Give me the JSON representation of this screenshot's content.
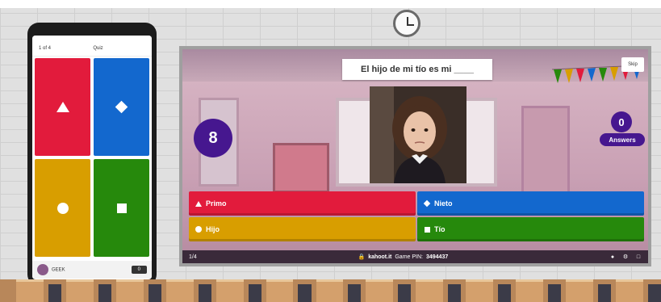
{
  "question": {
    "text": "El hijo de mi tío es mi ____"
  },
  "timer": {
    "value": "8"
  },
  "answers_count": {
    "value": "0",
    "label": "Answers"
  },
  "skip_button": {
    "label": "Skip"
  },
  "options": [
    {
      "label": "Primo",
      "color": "#e21b3c",
      "shape": "triangle-icon"
    },
    {
      "label": "Nieto",
      "color": "#1368ce",
      "shape": "diamond-icon"
    },
    {
      "label": "Hijo",
      "color": "#d89e00",
      "shape": "circle-icon"
    },
    {
      "label": "Tío",
      "color": "#26890c",
      "shape": "square-icon"
    }
  ],
  "bottom_bar": {
    "progress": "1/4",
    "site": "kahoot.it",
    "pin_label": "Game PIN:",
    "pin": "3494437"
  },
  "phone": {
    "top_left": "1 of 4",
    "top_center": "Quiz",
    "player_name": "GEEK",
    "score": "0"
  },
  "colors": {
    "purple": "#46178f",
    "red": "#e21b3c",
    "blue": "#1368ce",
    "yellow": "#d89e00",
    "green": "#26890c"
  }
}
